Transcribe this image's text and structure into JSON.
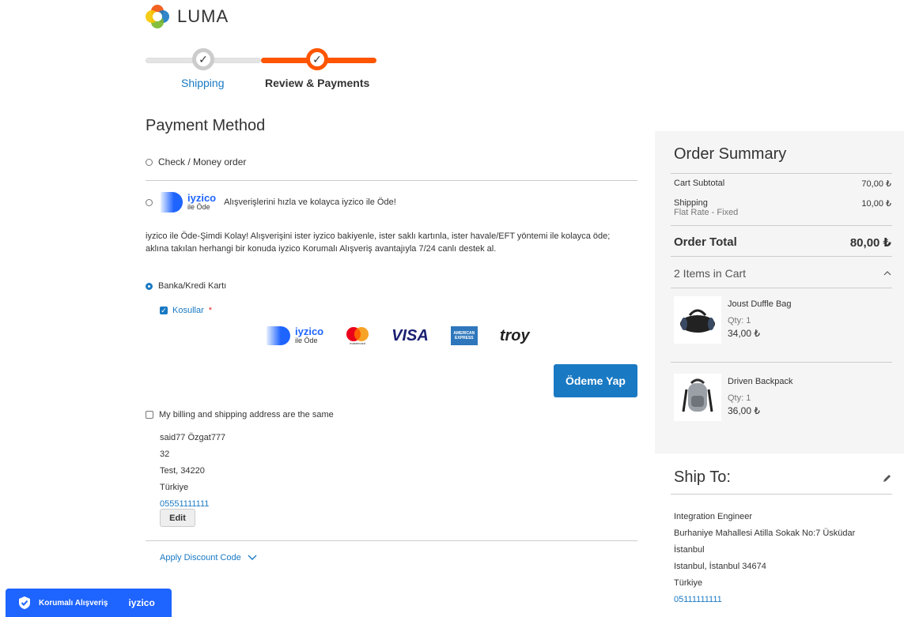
{
  "brand": {
    "name": "LUMA"
  },
  "progress": {
    "step1": "Shipping",
    "step2": "Review & Payments"
  },
  "payment": {
    "title": "Payment Method",
    "check_money": "Check / Money order",
    "iyzico_word": "iyzico",
    "iyzico_sub": "ile Öde",
    "iyzico_tagline": "Alışverişlerini hızla ve kolayca iyzico ile Öde!",
    "iyzico_desc_1": "iyzico ile Öde-Şimdi Kolay! Alışverişini ister iyzico bakiyenle, ister saklı kartınla, ister havale/EFT yöntemi ile kolayca öde;",
    "iyzico_desc_2": "aklına takılan herhangi bir konuda iyzico Korumalı Alışveriş avantajıyla 7/24 canlı destek al.",
    "card_option": "Banka/Kredi Kartı",
    "terms": "Kosullar",
    "required_mark": "*",
    "logos": {
      "visa": "VISA",
      "mastercard": "mastercard",
      "amex_1": "AMERICAN",
      "amex_2": "EXPRESS",
      "troy": "troy"
    },
    "pay_button": "Ödeme Yap",
    "same_address": "My billing and shipping address are the same",
    "address": [
      "said77 Özgat777",
      "32",
      "Test, 34220",
      "Türkiye"
    ],
    "phone": "05551111111",
    "edit": "Edit",
    "discount": "Apply Discount Code"
  },
  "summary": {
    "title": "Order Summary",
    "subtotal_label": "Cart Subtotal",
    "subtotal": "70,00 ₺",
    "shipping_label": "Shipping",
    "shipping_method": "Flat Rate - Fixed",
    "shipping": "10,00 ₺",
    "total_label": "Order Total",
    "total": "80,00 ₺",
    "items_label": "2 Items in Cart",
    "items": [
      {
        "name": "Joust Duffle Bag",
        "qty": "Qty: 1",
        "price": "34,00 ₺"
      },
      {
        "name": "Driven Backpack",
        "qty": "Qty: 1",
        "price": "36,00 ₺"
      }
    ]
  },
  "ship_to": {
    "title": "Ship To:",
    "lines": [
      "Integration Engineer",
      "Burhaniye Mahallesi Atilla Sokak No:7 Üsküdar",
      "İstanbul",
      "Istanbul, İstanbul 34674",
      "Türkiye"
    ],
    "phone": "05111111111"
  },
  "badge": {
    "label": "Korumalı Alışveriş",
    "brand": "iyzico"
  },
  "colors": {
    "accent": "#1979c3",
    "progress_active": "#ff5501",
    "iyzico": "#1e64ff"
  }
}
